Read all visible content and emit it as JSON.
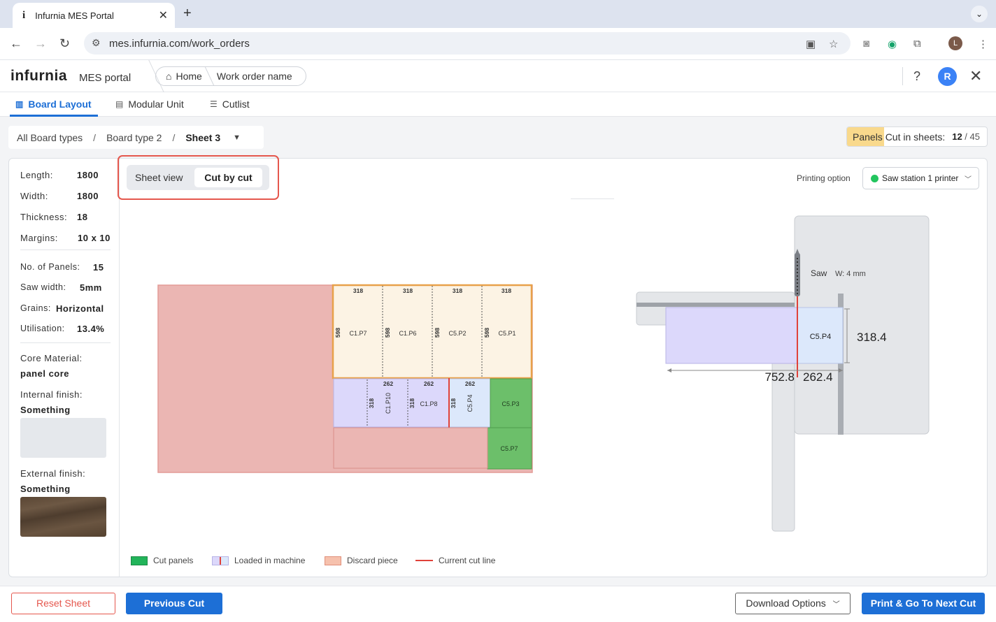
{
  "browser": {
    "tab_title": "Infurnia MES Portal",
    "tab_favicon": "i",
    "url": "mes.infurnia.com/work_orders",
    "profile_initial": "L"
  },
  "app": {
    "logo": "infurnia",
    "portal": "MES portal",
    "breadcrumb": [
      "Home",
      "Work order name"
    ],
    "user_initial": "R"
  },
  "tabs": [
    {
      "label": "Board Layout",
      "active": true
    },
    {
      "label": "Modular Unit",
      "active": false
    },
    {
      "label": "Cutlist",
      "active": false
    }
  ],
  "sheet_breadcrumb": {
    "all": "All Board types",
    "type": "Board type 2",
    "sheet": "Sheet 3"
  },
  "panels_cut": {
    "label": "Panels Cut in sheets:",
    "done": "12",
    "total": "45",
    "fraction": 0.2667
  },
  "properties": {
    "length_label": "Length:",
    "length": "1800",
    "width_label": "Width:",
    "width": "1800",
    "thickness_label": "Thickness:",
    "thickness": "18",
    "margins_label": "Margins:",
    "margins": "10 x 10",
    "panels_label": "No. of Panels:",
    "panels": "15",
    "saw_label": "Saw width:",
    "saw": "5mm",
    "grains_label": "Grains:",
    "grains": "Horizontal",
    "util_label": "Utilisation:",
    "util": "13.4%",
    "core_label": "Core Material:",
    "core": "panel core",
    "internal_label": "Internal finish:",
    "internal": "Something",
    "external_label": "External finish:",
    "external": "Something"
  },
  "view_toggle": {
    "sheet": "Sheet view",
    "cut": "Cut by cut",
    "selected": "cut"
  },
  "printing": {
    "label": "Printing option",
    "value": "Saw station 1 printer"
  },
  "layout_labels": {
    "widths_top": [
      "318",
      "318",
      "318",
      "318"
    ],
    "height_top": "598",
    "top_panels": [
      "C1.P7",
      "C1.P6",
      "C5.P2",
      "C5.P1"
    ],
    "mid_widths": [
      "262",
      "262",
      "262"
    ],
    "mid_height": "318",
    "mid_panels": [
      "C1.P10",
      "C1.P8",
      "C5.P4"
    ],
    "cut_panels": [
      "C5.P3",
      "C5.P7"
    ]
  },
  "saw_view": {
    "saw_label": "Saw",
    "saw_width": "W: 4 mm",
    "panel": "C5.P4",
    "height": "318.4",
    "left_len": "752.8",
    "right_len": "262.4"
  },
  "legend": {
    "cut": "Cut panels",
    "loaded": "Loaded in machine",
    "discard": "Discard piece",
    "current": "Current cut line"
  },
  "colors": {
    "accent": "#1d6fd6",
    "cut": "#6cbf6a",
    "loaded": "#dcd8fb",
    "discard": "#ebb6b3",
    "cutline": "#e0413a"
  },
  "footer": {
    "reset": "Reset Sheet",
    "previous": "Previous Cut",
    "download": "Download Options",
    "next": "Print & Go To Next Cut"
  }
}
